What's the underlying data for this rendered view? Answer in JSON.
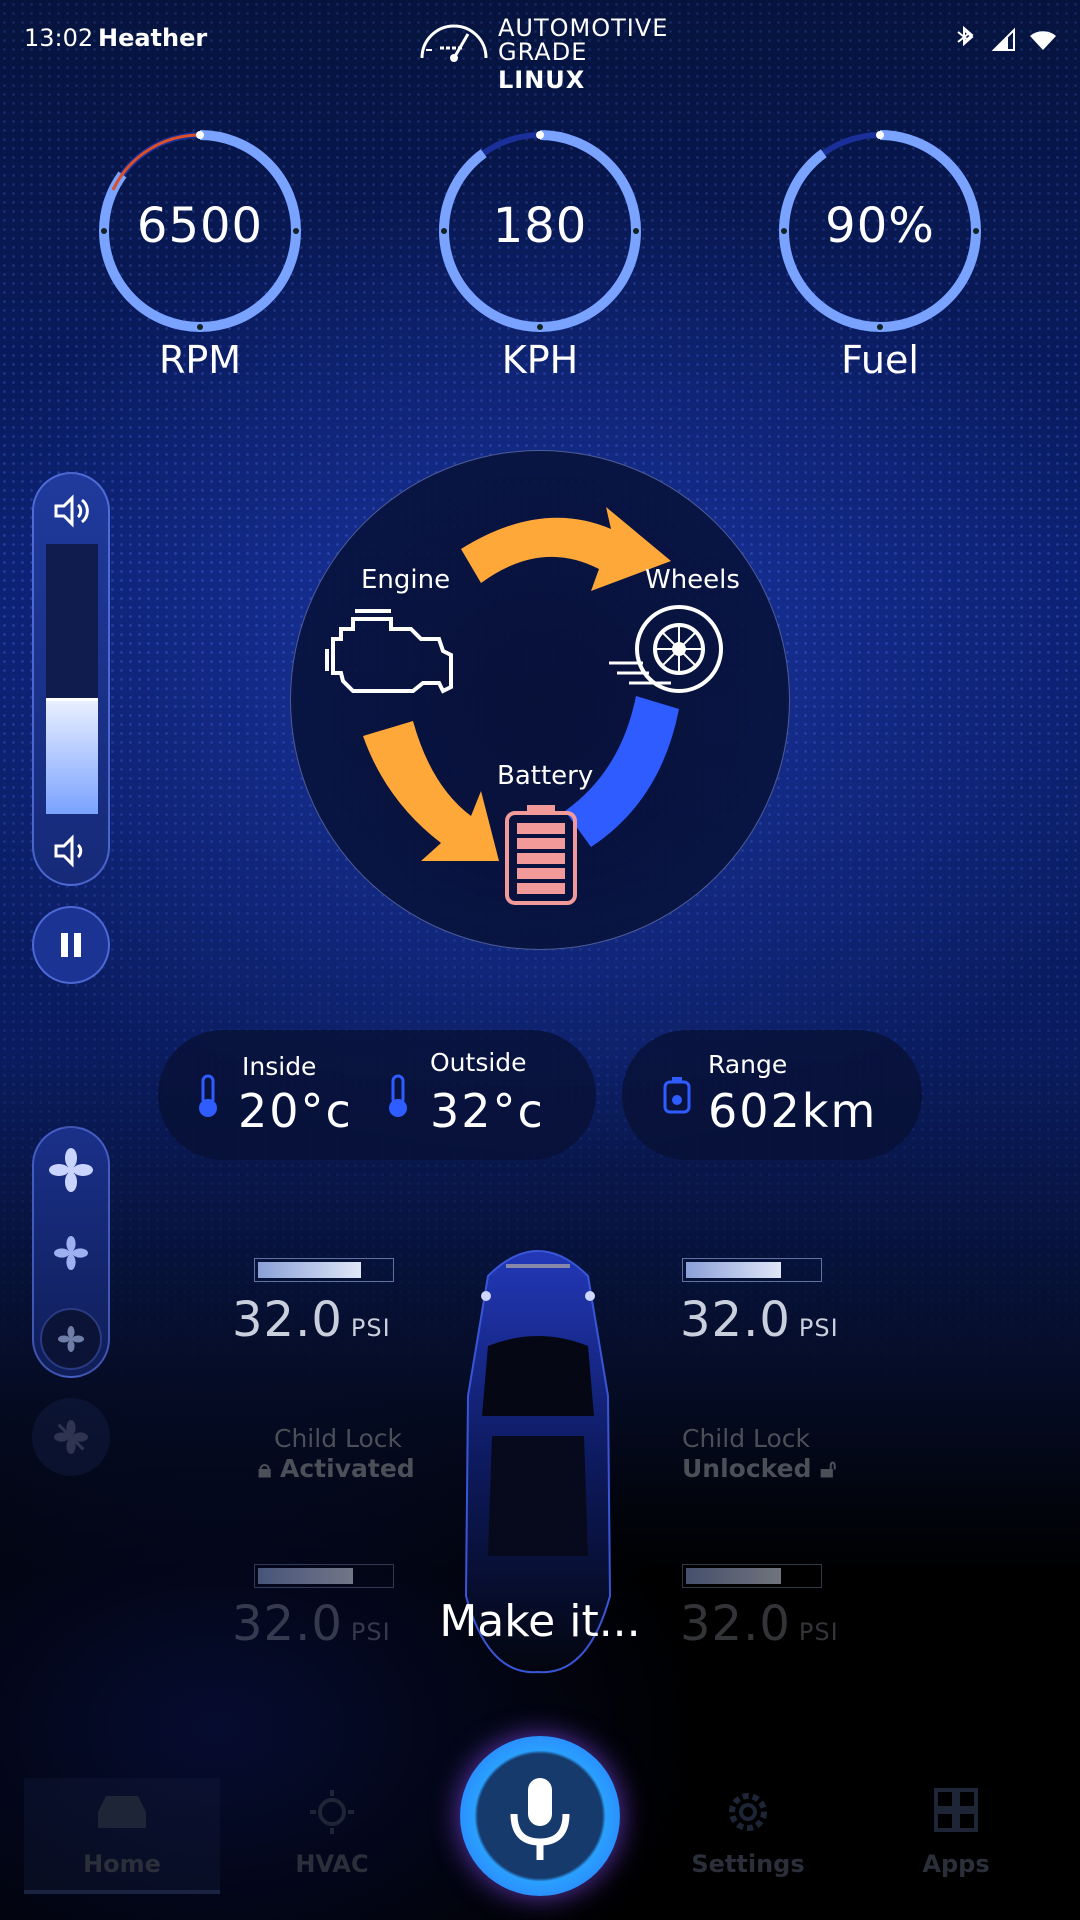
{
  "status_bar": {
    "time": "13:02",
    "user": "Heather",
    "logo_line1": "AUTOMOTIVE",
    "logo_line2_a": "GRADE",
    "logo_line2_b": "LINUX",
    "icons": [
      "bluetooth-icon",
      "signal-icon",
      "wifi-icon"
    ]
  },
  "gauges": [
    {
      "value": "6500",
      "label": "RPM",
      "fill_fraction": 0.85
    },
    {
      "value": "180",
      "label": "KPH",
      "fill_fraction": 0.9
    },
    {
      "value": "90%",
      "label": "Fuel",
      "fill_fraction": 0.9
    }
  ],
  "volume": {
    "level": 0.42
  },
  "energy_flow": {
    "engine_label": "Engine",
    "wheels_label": "Wheels",
    "battery_label": "Battery"
  },
  "climate": {
    "inside_label": "Inside",
    "inside_value": "20°c",
    "outside_label": "Outside",
    "outside_value": "32°c"
  },
  "range": {
    "label": "Range",
    "value": "602km"
  },
  "tires": {
    "front_left": {
      "value": "32.0",
      "unit": "PSI",
      "level": 0.78
    },
    "front_right": {
      "value": "32.0",
      "unit": "PSI",
      "level": 0.72
    },
    "rear_left": {
      "value": "32.0",
      "unit": "PSI",
      "level": 0.72
    },
    "rear_right": {
      "value": "32.0",
      "unit": "PSI",
      "level": 0.72
    }
  },
  "child_locks": {
    "left": {
      "label": "Child Lock",
      "state": "Activated"
    },
    "right": {
      "label": "Child Lock",
      "state": "Unlocked"
    }
  },
  "voice": {
    "prompt": "Make it..."
  },
  "nav": {
    "home": "Home",
    "hvac": "HVAC",
    "settings": "Settings",
    "apps": "Apps"
  },
  "colors": {
    "accent_blue": "#7aa2ff",
    "arrow_orange": "#ffa83a",
    "battery_pink": "#f29a9a",
    "regen_blue": "#2f5cff"
  }
}
